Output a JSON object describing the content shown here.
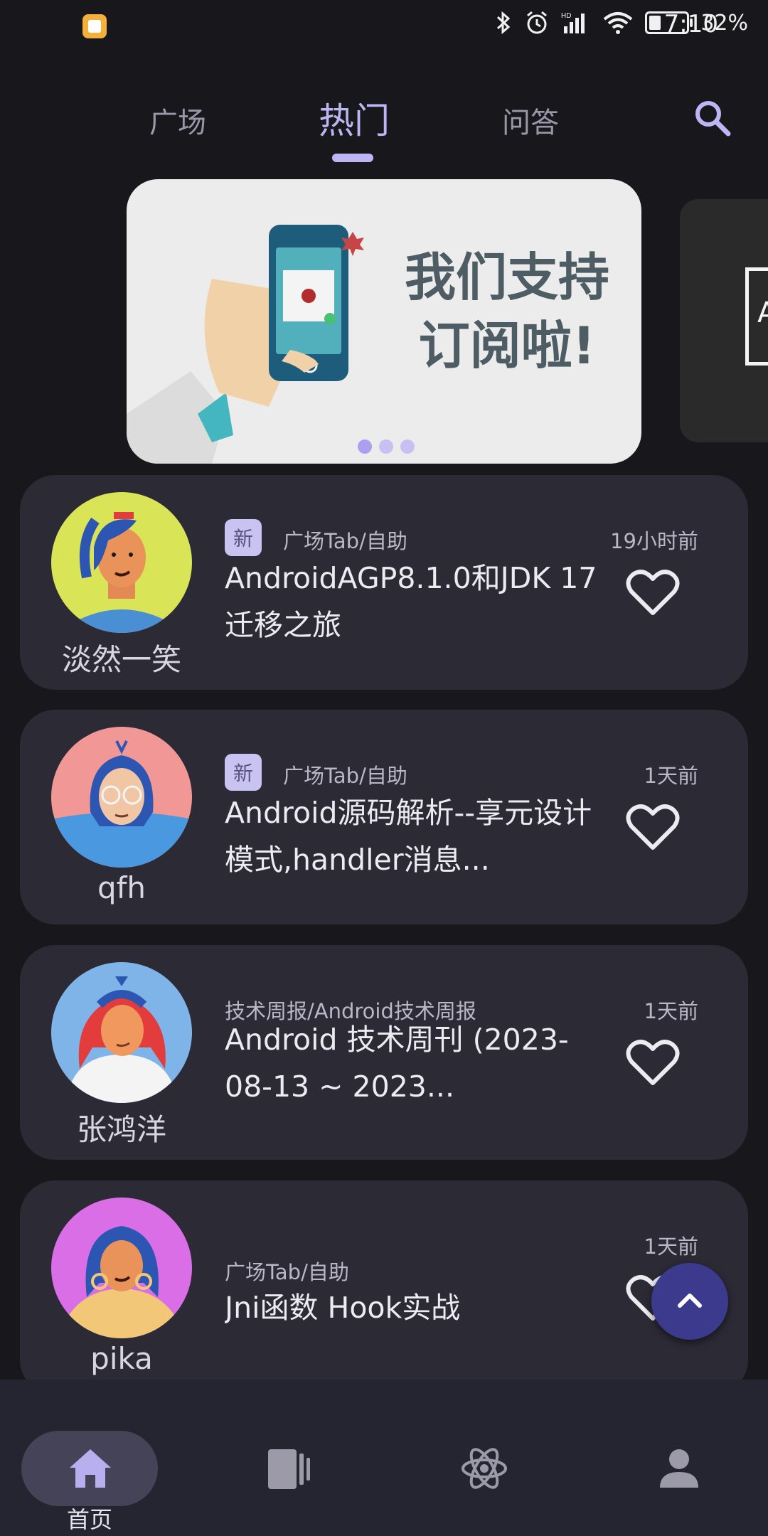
{
  "status_bar": {
    "time": "7:10",
    "battery": "32%"
  },
  "top_tabs": {
    "items": [
      "广场",
      "热门",
      "问答"
    ],
    "selected": "热门"
  },
  "banner": {
    "headline_line1": "我们支持",
    "headline_line2": "订阅啦!",
    "next_banner_letter": "A",
    "page_count": 3,
    "active_page": 1
  },
  "articles": [
    {
      "author": "淡然一笑",
      "is_new": true,
      "new_label": "新",
      "category": "广场Tab/自助",
      "title": "AndroidAGP8.1.0和JDK 17迁移之旅",
      "time": "19小时前"
    },
    {
      "author": "qfh",
      "is_new": true,
      "new_label": "新",
      "category": "广场Tab/自助",
      "title": "Android源码解析--享元设计模式,handler消息...",
      "time": "1天前"
    },
    {
      "author": "张鸿洋",
      "is_new": false,
      "new_label": "",
      "category": "技术周报/Android技术周报",
      "title": "Android 技术周刊 (2023-08-13 ~ 2023...",
      "time": "1天前"
    },
    {
      "author": "pika",
      "is_new": false,
      "new_label": "",
      "category": "广场Tab/自助",
      "title": "Jni函数 Hook实战",
      "time": "1天前"
    }
  ],
  "bottom_nav": {
    "items": [
      {
        "icon": "home-icon",
        "label": "首页"
      },
      {
        "icon": "book-icon",
        "label": ""
      },
      {
        "icon": "atom-icon",
        "label": ""
      },
      {
        "icon": "person-icon",
        "label": ""
      }
    ],
    "selected": "首页"
  },
  "colors": {
    "background": "#18181c",
    "card": "#2b2a35",
    "accent": "#bdb6f5",
    "fab": "#3c3a8c",
    "nav_bg": "#252431"
  }
}
